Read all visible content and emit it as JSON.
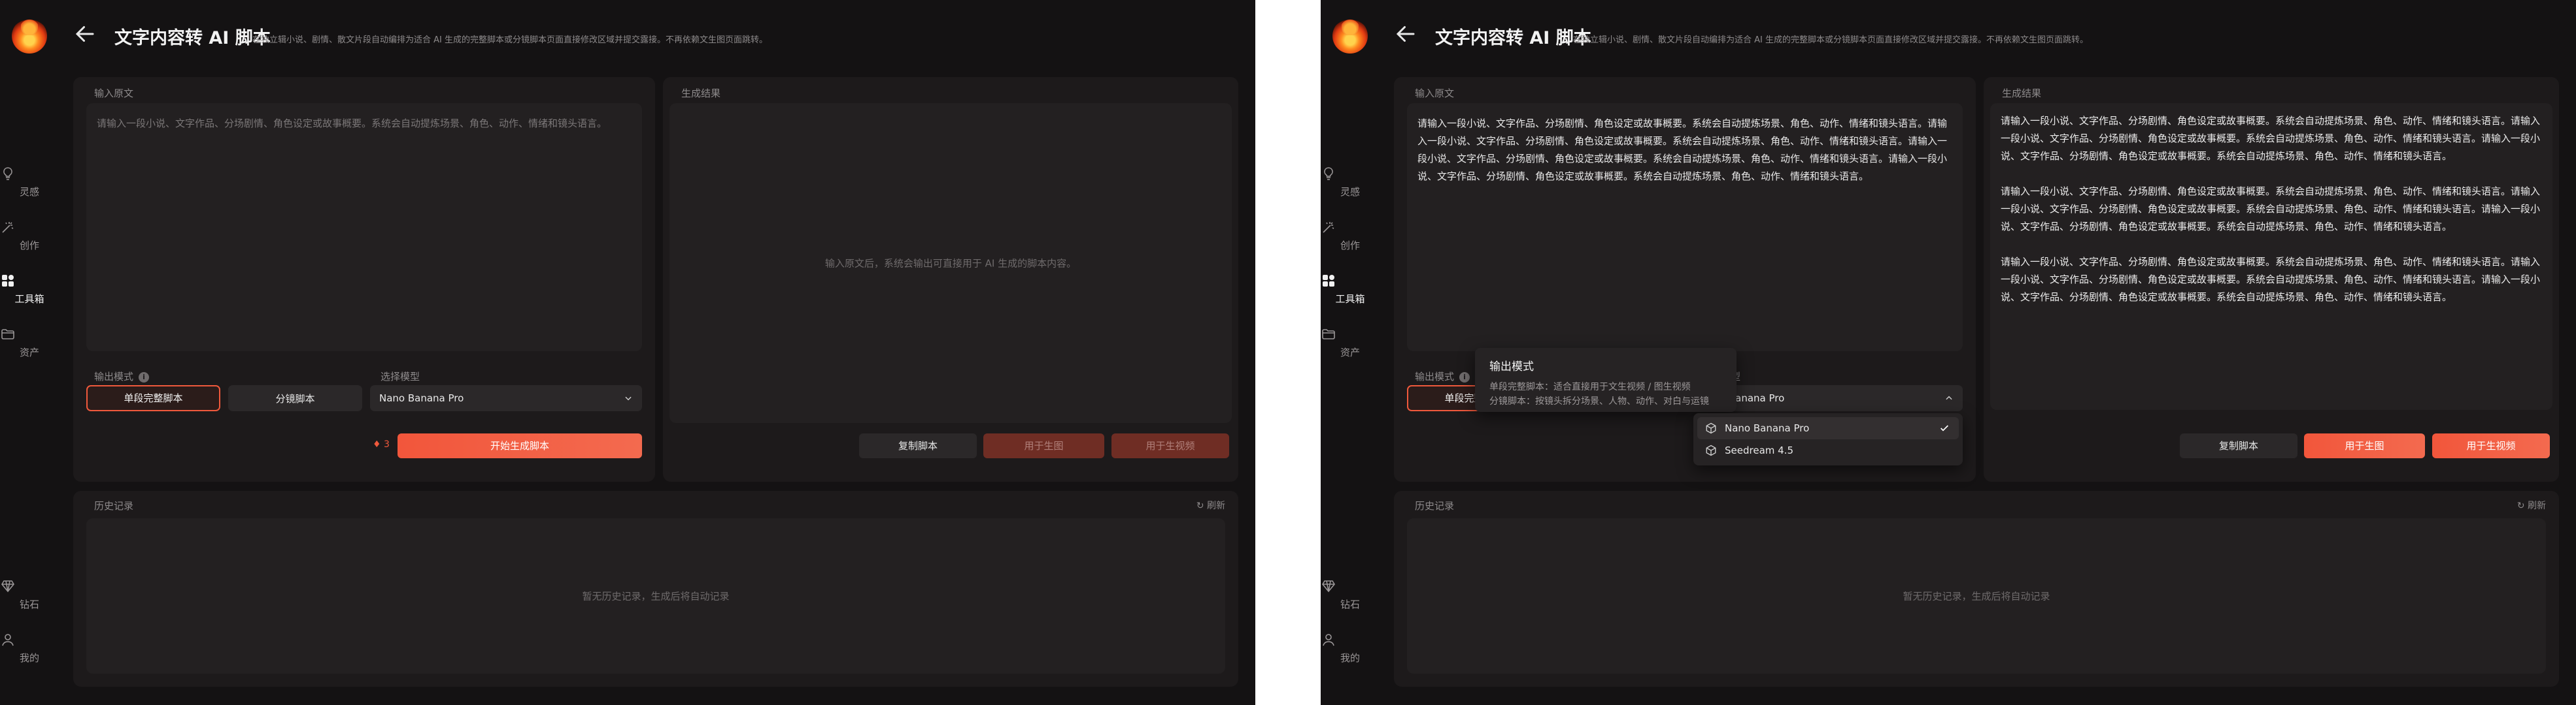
{
  "nav": {
    "items": [
      {
        "label": "灵感",
        "icon": "lightbulb-icon"
      },
      {
        "label": "创作",
        "icon": "magic-wand-icon"
      },
      {
        "label": "工具箱",
        "icon": "grid-icon"
      },
      {
        "label": "资产",
        "icon": "folder-icon"
      }
    ],
    "bottom": [
      {
        "label": "钻石",
        "icon": "diamond-icon"
      },
      {
        "label": "我的",
        "icon": "user-icon"
      }
    ],
    "active_label": "工具箱"
  },
  "header": {
    "title": "文字内容转 AI 脚本",
    "subtitle": "在独立辑小说、剧情、散文片段自动编排为适合 AI 生成的完整脚本或分镜脚本页面直接修改区域并提交露接。不再依赖文生图页面跳转。"
  },
  "input_panel": {
    "label": "输入原文",
    "placeholder": "请输入一段小说、文字作品、分场剧情、角色设定或故事概要。系统会自动提炼场景、角色、动作、情绪和镜头语言。",
    "value": "请输入一段小说、文字作品、分场剧情、角色设定或故事概要。系统会自动提炼场景、角色、动作、情绪和镜头语言。请输入一段小说、文字作品、分场剧情、角色设定或故事概要。系统会自动提炼场景、角色、动作、情绪和镜头语言。请输入一段小说、文字作品、分场剧情、角色设定或故事概要。系统会自动提炼场景、角色、动作、情绪和镜头语言。请输入一段小说、文字作品、分场剧情、角色设定或故事概要。系统会自动提炼场景、角色、动作、情绪和镜头语言。"
  },
  "output_mode": {
    "label": "输出模式",
    "options": [
      "单段完整脚本",
      "分镜脚本"
    ],
    "selected": "单段完整脚本"
  },
  "model_select": {
    "label": "选择模型",
    "value": "Nano Banana Pro",
    "value_truncated": "Banana Pro",
    "options": [
      "Nano Banana Pro",
      "Seedream 4.5"
    ]
  },
  "generate": {
    "credits": "3",
    "label": "开始生成脚本"
  },
  "result_panel": {
    "label": "生成结果",
    "placeholder": "输入原文后，系统会输出可直接用于 AI 生成的脚本内容。",
    "paragraphs": [
      "请输入一段小说、文字作品、分场剧情、角色设定或故事概要。系统会自动提炼场景、角色、动作、情绪和镜头语言。请输入一段小说、文字作品、分场剧情、角色设定或故事概要。系统会自动提炼场景、角色、动作、情绪和镜头语言。请输入一段小说、文字作品、分场剧情、角色设定或故事概要。系统会自动提炼场景、角色、动作、情绪和镜头语言。",
      "请输入一段小说、文字作品、分场剧情、角色设定或故事概要。系统会自动提炼场景、角色、动作、情绪和镜头语言。请输入一段小说、文字作品、分场剧情、角色设定或故事概要。系统会自动提炼场景、角色、动作、情绪和镜头语言。请输入一段小说、文字作品、分场剧情、角色设定或故事概要。系统会自动提炼场景、角色、动作、情绪和镜头语言。",
      "请输入一段小说、文字作品、分场剧情、角色设定或故事概要。系统会自动提炼场景、角色、动作、情绪和镜头语言。请输入一段小说、文字作品、分场剧情、角色设定或故事概要。系统会自动提炼场景、角色、动作、情绪和镜头语言。请输入一段小说、文字作品、分场剧情、角色设定或故事概要。系统会自动提炼场景、角色、动作、情绪和镜头语言。"
    ],
    "actions": {
      "copy": "复制脚本",
      "image": "用于生图",
      "video": "用于生视频"
    }
  },
  "history": {
    "label": "历史记录",
    "refresh": "刷新",
    "empty": "暂无历史记录，生成后将自动记录"
  },
  "tooltip": {
    "title": "输出模式",
    "lines": [
      "单段完整脚本：适合直接用于文生视频 / 图生视频",
      "分镜脚本：按镜头拆分场景、人物、动作、对白与运镜"
    ]
  },
  "colors": {
    "accent": "#f2563b",
    "background": "#141213",
    "panel": "#1d1a1b"
  }
}
